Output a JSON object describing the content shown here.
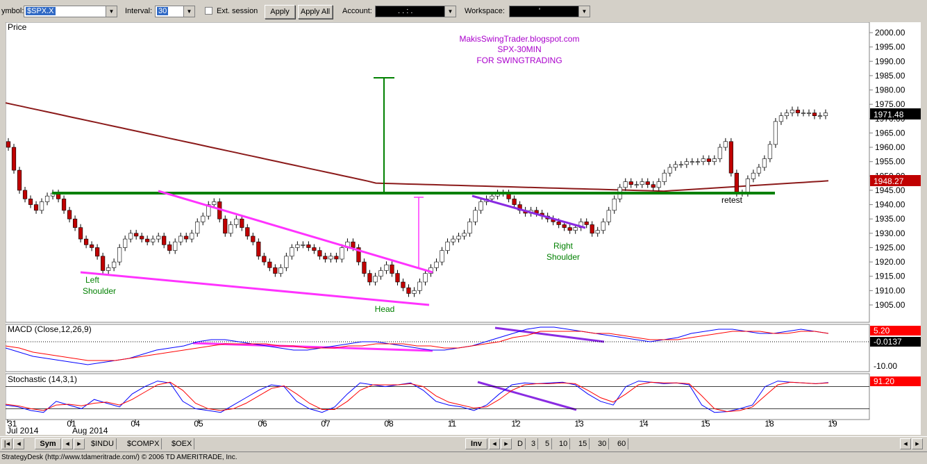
{
  "toolbar": {
    "symbol_label": "ymbol:",
    "symbol_value": "$SPX.X",
    "interval_label": "Interval:",
    "interval_value": "30",
    "ext_session_label": "Ext. session",
    "apply_label": "Apply",
    "apply_all_label": "Apply All",
    "account_label": "Account:",
    "account_value": ". . : .",
    "workspace_label": "Workspace:",
    "workspace_value": "'"
  },
  "annotations": {
    "watermark": [
      "MakisSwingTrader.blogspot.com",
      "SPX-30MIN",
      "FOR SWINGTRADING"
    ],
    "left_shoulder": [
      "Left",
      "Shoulder"
    ],
    "head": "Head",
    "right_shoulder": [
      "Right",
      "Shoulder"
    ],
    "retest": "retest"
  },
  "colors": {
    "price_up": "#ffffff",
    "price_down": "#c00000",
    "ma": "#8b1a1a",
    "neckline": "#008000",
    "wedge": "#ff33ff",
    "trendline": "#8a2be2",
    "annotation_green": "#008000",
    "watermark": "#aa00cc",
    "macd_line": "#0000ff",
    "signal_line": "#ff0000",
    "last_price_bg": "#000000",
    "ma_label_bg": "#c00000",
    "stoch_label_bg": "#ff0000"
  },
  "chart_data": [
    {
      "type": "candlestick",
      "title": "Price",
      "y_ticks": [
        "2000.00",
        "1995.00",
        "1990.00",
        "1985.00",
        "1980.00",
        "1975.00",
        "1970.00",
        "1965.00",
        "1960.00",
        "1955.00",
        "1950.00",
        "1945.00",
        "1940.00",
        "1935.00",
        "1930.00",
        "1925.00",
        "1920.00",
        "1915.00",
        "1910.00",
        "1905.00"
      ],
      "ylim": [
        1901,
        2003
      ],
      "last_price_label": "1971.48",
      "ma_label": "1948.27",
      "x_ticks": [
        "31",
        "01",
        "04",
        "05",
        "06",
        "07",
        "08",
        "11",
        "12",
        "13",
        "14",
        "15",
        "18",
        "19"
      ],
      "date_labels": [
        "Jul 2014",
        "Aug 2014"
      ],
      "close": [
        1960,
        1952,
        1945,
        1942,
        1940,
        1938,
        1941,
        1943,
        1944,
        1942,
        1938,
        1935,
        1932,
        1928,
        1926,
        1925,
        1922,
        1917,
        1918,
        1920,
        1925,
        1928,
        1930,
        1929,
        1928,
        1927,
        1928,
        1929,
        1926,
        1924,
        1927,
        1929,
        1928,
        1930,
        1934,
        1936,
        1940,
        1941,
        1935,
        1930,
        1933,
        1935,
        1932,
        1929,
        1927,
        1922,
        1920,
        1918,
        1916,
        1918,
        1922,
        1925,
        1926,
        1926,
        1925,
        1924,
        1922,
        1921,
        1922,
        1921,
        1925,
        1927,
        1925,
        1920,
        1916,
        1913,
        1915,
        1917,
        1919,
        1916,
        1913,
        1911,
        1909,
        1910,
        1913,
        1916,
        1918,
        1920,
        1924,
        1927,
        1928,
        1929,
        1930,
        1934,
        1938,
        1941,
        1942,
        1943,
        1944,
        1944,
        1942,
        1940,
        1938,
        1937,
        1938,
        1937,
        1936,
        1935,
        1934,
        1933,
        1932,
        1931,
        1932,
        1934,
        1933,
        1930,
        1931,
        1934,
        1938,
        1942,
        1946,
        1948,
        1947,
        1947,
        1948,
        1947,
        1946,
        1948,
        1951,
        1953,
        1954,
        1954,
        1955,
        1955,
        1955,
        1956,
        1955,
        1956,
        1960,
        1962,
        1951,
        1944,
        1944,
        1949,
        1951,
        1953,
        1956,
        1961,
        1969,
        1971,
        1972,
        1973,
        1972,
        1972,
        1972,
        1971,
        1971,
        1972
      ]
    },
    {
      "type": "macd",
      "title": "MACD (Close,12,26,9)",
      "y_ticks": [
        "5.20",
        "-0.0137",
        "-10.00"
      ],
      "series": [
        {
          "name": "MACD",
          "values": [
            -3,
            -5,
            -7,
            -8,
            -9,
            -10,
            -11,
            -10,
            -9,
            -8,
            -6,
            -4,
            -3,
            -2,
            0,
            1,
            1,
            0,
            -1,
            -2,
            -3,
            -4,
            -4,
            -3,
            -2,
            -1,
            0,
            0,
            -1,
            -2,
            -3,
            -4,
            -4,
            -3,
            -2,
            0,
            2,
            4,
            6,
            7,
            7,
            6,
            5,
            4,
            3,
            2,
            1,
            0,
            1,
            2,
            4,
            5,
            6,
            6,
            5,
            4,
            4,
            5,
            6,
            5,
            4
          ]
        },
        {
          "name": "Signal",
          "values": [
            -2,
            -3,
            -5,
            -6,
            -7,
            -8,
            -9,
            -9,
            -9,
            -8,
            -7,
            -6,
            -5,
            -4,
            -3,
            -2,
            -1,
            -1,
            -1,
            -1,
            -2,
            -2,
            -3,
            -3,
            -3,
            -2,
            -2,
            -1,
            -1,
            -1,
            -2,
            -2,
            -3,
            -3,
            -2,
            -1,
            0,
            2,
            3,
            5,
            5,
            5,
            5,
            4,
            4,
            3,
            2,
            1,
            1,
            1,
            2,
            3,
            4,
            5,
            5,
            5,
            4,
            4,
            5,
            5,
            4
          ]
        }
      ]
    },
    {
      "type": "stochastic",
      "title": "Stochastic (14,3,1)",
      "value_label": "91.20",
      "series": [
        {
          "name": "%K",
          "values": [
            30,
            25,
            15,
            10,
            40,
            30,
            20,
            45,
            35,
            25,
            60,
            80,
            95,
            90,
            40,
            20,
            15,
            10,
            30,
            50,
            70,
            85,
            80,
            40,
            20,
            10,
            25,
            60,
            90,
            85,
            80,
            85,
            90,
            70,
            40,
            30,
            25,
            15,
            30,
            60,
            85,
            90,
            88,
            90,
            92,
            85,
            60,
            40,
            30,
            80,
            95,
            92,
            88,
            90,
            85,
            30,
            10,
            12,
            20,
            30,
            80,
            95,
            92,
            90,
            88,
            91
          ]
        },
        {
          "name": "%D",
          "values": [
            32,
            28,
            20,
            15,
            30,
            32,
            28,
            35,
            38,
            30,
            45,
            65,
            85,
            92,
            70,
            35,
            20,
            15,
            20,
            35,
            55,
            75,
            82,
            60,
            35,
            18,
            18,
            40,
            70,
            85,
            85,
            85,
            88,
            80,
            55,
            38,
            30,
            22,
            25,
            45,
            70,
            85,
            88,
            88,
            90,
            88,
            70,
            50,
            38,
            60,
            85,
            92,
            90,
            90,
            88,
            55,
            20,
            12,
            15,
            25,
            55,
            85,
            92,
            90,
            88,
            90
          ]
        }
      ]
    }
  ],
  "navbar": {
    "sym_label": "Sym",
    "tabs": [
      "$INDU",
      "$COMPX",
      "$OEX"
    ],
    "inv_label": "Inv",
    "periods": [
      "D",
      "3",
      "5",
      "10",
      "15",
      "30",
      "60"
    ]
  },
  "status": {
    "text": "StrategyDesk (http://www.tdameritrade.com/) © 2006 TD AMERITRADE, Inc."
  }
}
